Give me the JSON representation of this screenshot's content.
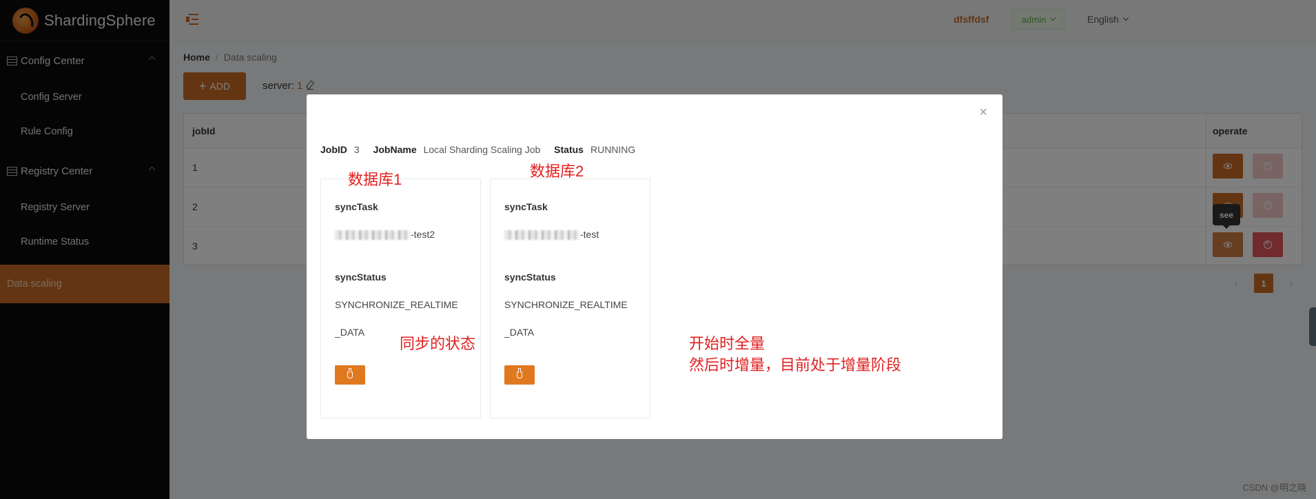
{
  "app": {
    "logo_text": "ShardingSphere"
  },
  "sidebar": {
    "groups": [
      {
        "label": "Config Center",
        "items": [
          "Config Server",
          "Rule Config"
        ]
      },
      {
        "label": "Registry Center",
        "items": [
          "Registry Server",
          "Runtime Status"
        ]
      }
    ],
    "active_item": "Data scaling"
  },
  "header": {
    "username": "dfsffdsf",
    "role": "admin",
    "language": "English"
  },
  "breadcrumb": {
    "home": "Home",
    "current": "Data scaling"
  },
  "toolbar": {
    "add_label": "ADD",
    "server_label": "server:",
    "server_value": "1"
  },
  "table": {
    "headers": {
      "job_id": "jobId",
      "operate": "operate"
    },
    "rows": [
      "1",
      "2",
      "3"
    ],
    "tooltip": "see"
  },
  "pagination": {
    "current": "1"
  },
  "modal": {
    "job_id_label": "JobID",
    "job_id": "3",
    "job_name_label": "JobName",
    "job_name": "Local Sharding Scaling Job",
    "status_label": "Status",
    "status": "RUNNING",
    "cards": [
      {
        "sync_task_label": "syncTask",
        "sync_task_suffix": "-test2",
        "sync_status_label": "syncStatus",
        "sync_status_line1": "SYNCHRONIZE_REALTIME",
        "sync_status_line2": "_DATA"
      },
      {
        "sync_task_label": "syncTask",
        "sync_task_suffix": "-test",
        "sync_status_label": "syncStatus",
        "sync_status_line1": "SYNCHRONIZE_REALTIME",
        "sync_status_line2": "_DATA"
      }
    ]
  },
  "annotations": {
    "db1": "数据库1",
    "db2": "数据库2",
    "sync_state": "同步的状态",
    "phase_line1": "开始时全量",
    "phase_line2": "然后时增量，目前处于增量阶段"
  },
  "watermark": "CSDN @明之晓",
  "colors": {
    "brand": "#c86a24",
    "sidebar_bg": "#0b0b0b",
    "annotation": "#e21f1f",
    "danger": "#e25758"
  }
}
